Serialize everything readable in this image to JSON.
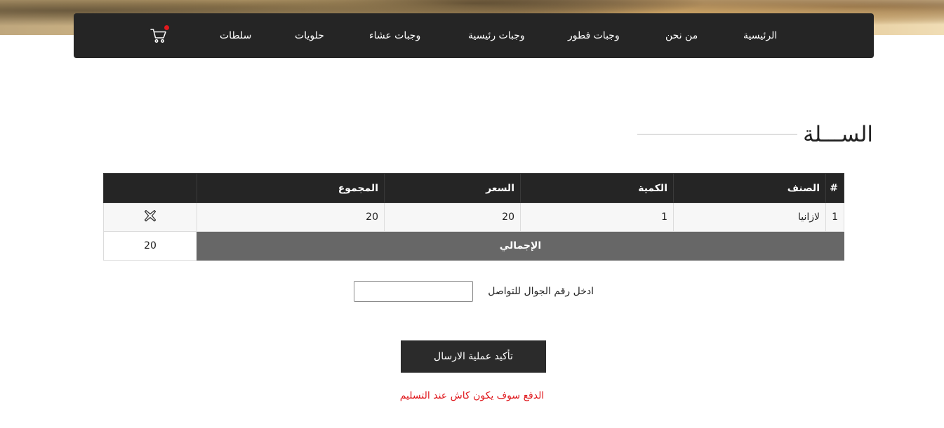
{
  "nav": {
    "items": [
      "الرئيسية",
      "من نحن",
      "وجبات فطور",
      "وجبات رئيسية",
      "وجبات عشاء",
      "حلويات",
      "سلطات"
    ],
    "cart_icon": "cart-icon",
    "cart_badge_color": "#e0191e"
  },
  "page": {
    "title": "الســـلة"
  },
  "cart": {
    "headers": {
      "index": "#",
      "item": "الصنف",
      "quantity": "الكمية",
      "price": "السعر",
      "total": "المجموع",
      "action": ""
    },
    "rows": [
      {
        "index": "1",
        "item": "لازانيا",
        "quantity": "1",
        "price": "20",
        "total": "20",
        "remove_icon": "close-icon"
      }
    ],
    "grand_total_label": "الإجمالي",
    "grand_total_value": "20"
  },
  "contact": {
    "phone_label": "ادخل رقم الجوال للتواصل",
    "phone_value": "",
    "phone_placeholder": ""
  },
  "actions": {
    "confirm_label": "تأكيد عملية الارسال"
  },
  "notice": {
    "payment_note": "الدفع سوف يكون كاش عند التسليم",
    "color": "#e0191e"
  }
}
